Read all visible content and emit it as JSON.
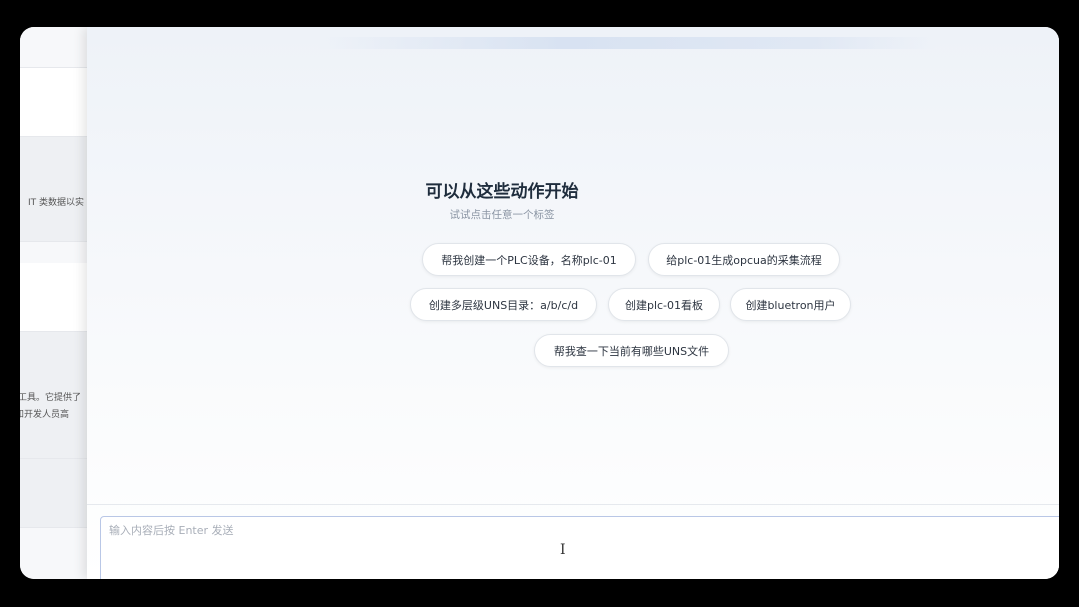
{
  "background_panel": {
    "text_1": "IT 类数据以实",
    "text_2": "工具。它提供了",
    "text_3": "和开发人员高"
  },
  "main": {
    "title": "可以从这些动作开始",
    "subtitle": "试试点击任意一个标签",
    "suggestions": [
      {
        "label": "帮我创建一个PLC设备，名称plc-01"
      },
      {
        "label": "给plc-01生成opcua的采集流程"
      },
      {
        "label": "创建多层级UNS目录：a/b/c/d"
      },
      {
        "label": "创建plc-01看板"
      },
      {
        "label": "创建bluetron用户"
      },
      {
        "label": "帮我查一下当前有哪些UNS文件"
      }
    ]
  },
  "input": {
    "placeholder": "输入内容后按 Enter 发送",
    "value": ""
  },
  "icons": {
    "text_cursor": "text-cursor-icon"
  }
}
